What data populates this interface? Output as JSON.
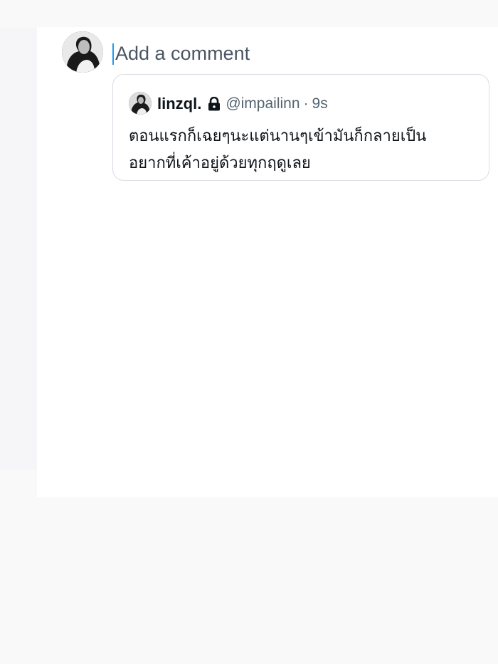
{
  "composer": {
    "placeholder": "Add a comment"
  },
  "quoted_post": {
    "display_name": "linzql.",
    "handle": "@impailinn",
    "separator": "·",
    "time": "9s",
    "text": "ตอนแรกก็เฉยๆนะแต่นานๆเข้ามันก็กลายเป็น\nอยากที่เค้าอยู่ด้วยทุกฤดูเลย",
    "protected_icon": "lock-icon"
  },
  "colors": {
    "cursor": "#1d9bf0",
    "name": "#0f1419",
    "secondary": "#536471",
    "card_border": "#d8dde2"
  }
}
